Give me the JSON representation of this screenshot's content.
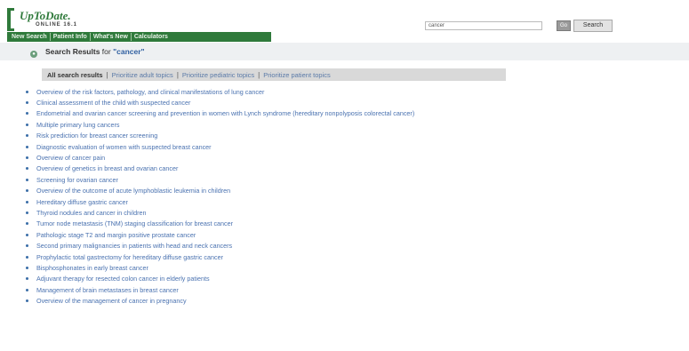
{
  "header": {
    "logo_name": "UpToDate.",
    "logo_sub": "ONLINE 16.1",
    "nav": [
      "New Search",
      "Patient Info",
      "What's New",
      "Calculators"
    ],
    "search_value": "cancer",
    "go_label": "Go",
    "search_button": "Search"
  },
  "results_header": {
    "prefix": "Search Results",
    "for_text": "for",
    "query": "\"cancer\""
  },
  "tabs": [
    "All search results",
    "Prioritize adult topics",
    "Prioritize pediatric topics",
    "Prioritize patient topics"
  ],
  "results": [
    "Overview of the risk factors, pathology, and clinical manifestations of lung cancer",
    "Clinical assessment of the child with suspected cancer",
    "Endometrial and ovarian cancer screening and prevention in women with Lynch syndrome (hereditary nonpolyposis colorectal cancer)",
    "Multiple primary lung cancers",
    "Risk prediction for breast cancer screening",
    "Diagnostic evaluation of women with suspected breast cancer",
    "Overview of cancer pain",
    "Overview of genetics in breast and ovarian cancer",
    "Screening for ovarian cancer",
    "Overview of the outcome of acute lymphoblastic leukemia in children",
    "Hereditary diffuse gastric cancer",
    "Thyroid nodules and cancer in children",
    "Tumor node metastasis (TNM) staging classification for breast cancer",
    "Pathologic stage T2 and margin positive prostate cancer",
    "Second primary malignancies in patients with head and neck cancers",
    "Prophylactic total gastrectomy for hereditary diffuse gastric cancer",
    "Bisphosphonates in early breast cancer",
    "Adjuvant therapy for resected colon cancer in elderly patients",
    "Management of brain metastases in breast cancer",
    "Overview of the management of cancer in pregnancy"
  ]
}
